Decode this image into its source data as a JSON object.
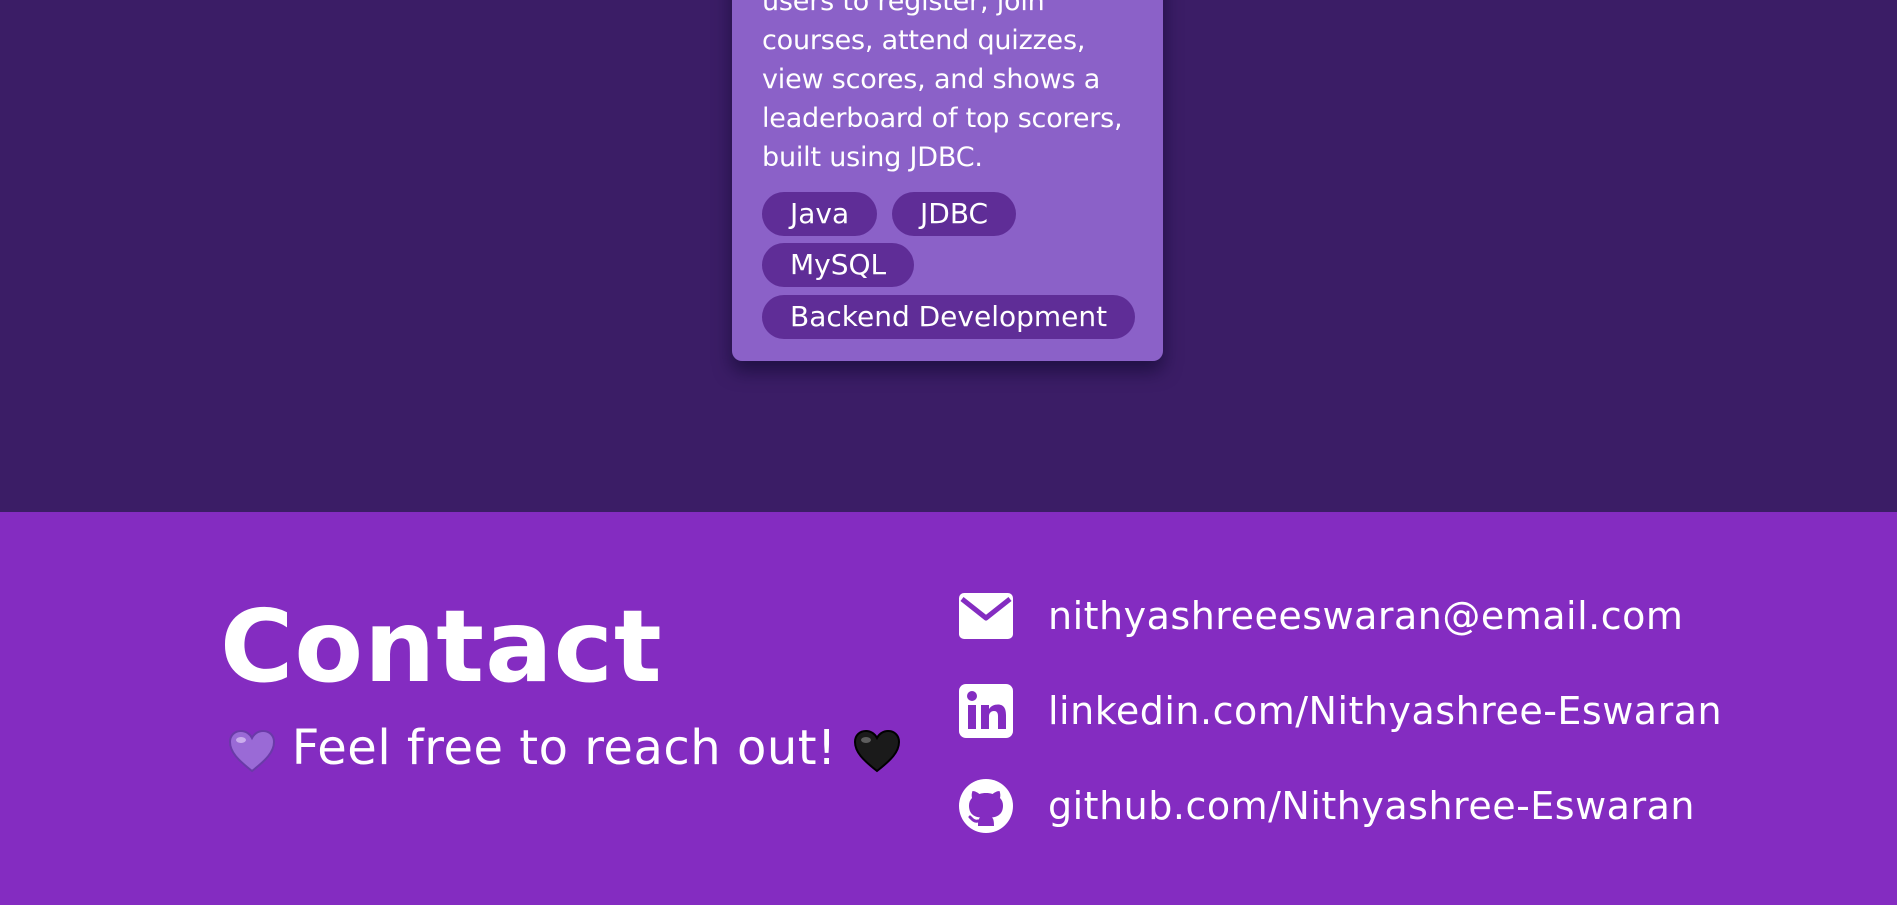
{
  "project": {
    "description": "users to register, join courses, attend quizzes, view scores, and shows a leaderboard of top scorers, built using JDBC.",
    "tags": [
      "Java",
      "JDBC",
      "MySQL",
      "Backend Development"
    ]
  },
  "contact": {
    "title": "Contact",
    "subtitle": "Feel free to reach out!",
    "subtitle_icons": [
      "purple-heart-icon",
      "black-heart-icon"
    ],
    "items": [
      {
        "icon": "mail-icon",
        "label": "nithyashreeeswaran@email.com"
      },
      {
        "icon": "linkedin-icon",
        "label": "linkedin.com/Nithyashree-Eswaran"
      },
      {
        "icon": "github-icon",
        "label": "github.com/Nithyashree-Eswaran"
      }
    ]
  },
  "colors": {
    "projects_background": "#3b1d66",
    "card_background": "#8b61c8",
    "tag_background": "#5f2d97",
    "contact_background": "#842cc1",
    "text": "#ffffff"
  }
}
